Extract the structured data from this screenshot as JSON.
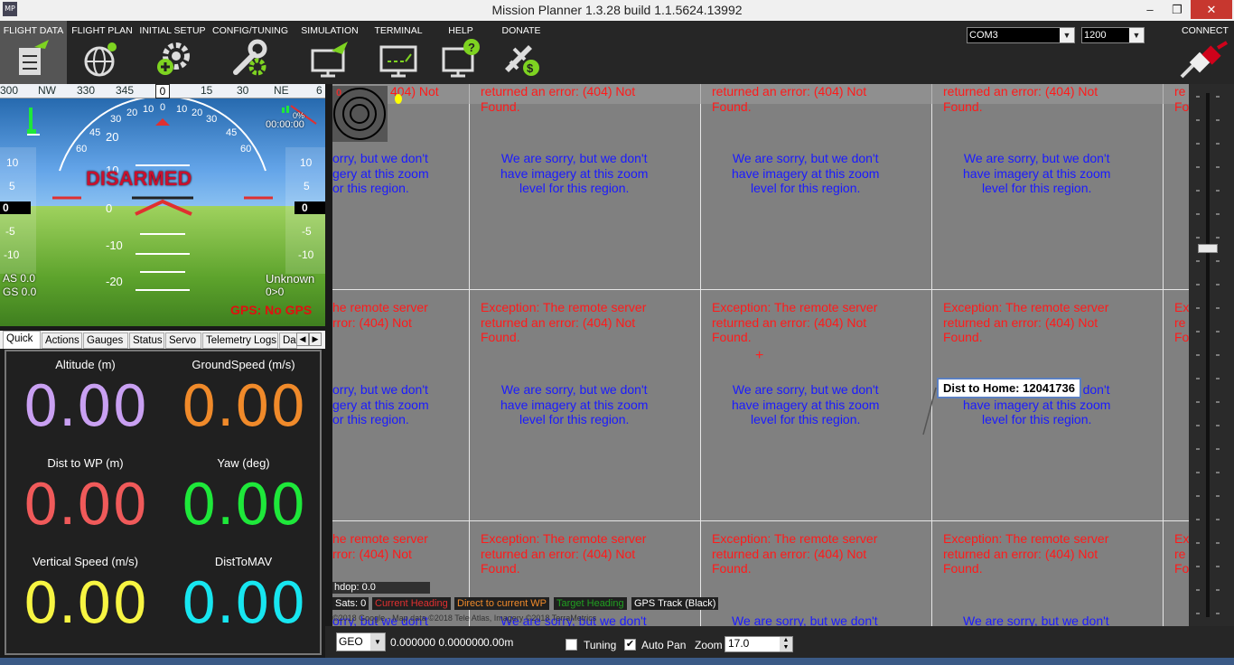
{
  "window": {
    "title": "Mission Planner 1.3.28 build 1.1.5624.13992",
    "icon_text": "MP",
    "minimize": "–",
    "restore": "❐",
    "close": "✕"
  },
  "menu": {
    "items": [
      {
        "label": "FLIGHT DATA",
        "icon": "flight-data-icon"
      },
      {
        "label": "FLIGHT PLAN",
        "icon": "flight-plan-icon"
      },
      {
        "label": "INITIAL SETUP",
        "icon": "initial-setup-icon"
      },
      {
        "label": "CONFIG/TUNING",
        "icon": "config-tuning-icon"
      },
      {
        "label": "SIMULATION",
        "icon": "simulation-icon"
      },
      {
        "label": "TERMINAL",
        "icon": "terminal-icon"
      },
      {
        "label": "HELP",
        "icon": "help-icon"
      },
      {
        "label": "DONATE",
        "icon": "donate-icon"
      }
    ],
    "port": "COM3",
    "baud": "1200",
    "connect_label": "CONNECT"
  },
  "hud": {
    "heading_ticks": [
      "300",
      "NW",
      "330",
      "345",
      "0",
      "15",
      "30",
      "NE",
      "6"
    ],
    "heading_value": "0",
    "status": "DISARMED",
    "roll_ticks": [
      "60",
      "45",
      "30",
      "20",
      "10",
      "0",
      "10",
      "20",
      "30",
      "45",
      "60"
    ],
    "pitch_labels": [
      "20",
      "10",
      "0",
      "-10",
      "-20"
    ],
    "left_tape": [
      "10",
      "5",
      "0",
      "-5",
      "-10"
    ],
    "right_tape": [
      "10",
      "5",
      "0",
      "-5",
      "-10"
    ],
    "as": "AS 0.0",
    "gs": "GS 0.0",
    "timer": "00:00:00",
    "mode": "Unknown",
    "wp": "0>0",
    "gps": "GPS: No GPS",
    "battery_marker": "0%"
  },
  "tabs": {
    "items": [
      "Quick",
      "Actions",
      "Gauges",
      "Status",
      "Servo",
      "Telemetry Logs",
      "Da"
    ],
    "scroll_left": "◀",
    "scroll_right": "▶"
  },
  "quick": [
    {
      "label": "Altitude (m)",
      "value": "0.00",
      "color": "#c9a0f2"
    },
    {
      "label": "GroundSpeed (m/s)",
      "value": "0.00",
      "color": "#f08a2a"
    },
    {
      "label": "Dist to WP (m)",
      "value": "0.00",
      "color": "#f05a5a"
    },
    {
      "label": "Yaw (deg)",
      "value": "0.00",
      "color": "#1ee83a"
    },
    {
      "label": "Vertical Speed (m/s)",
      "value": "0.00",
      "color": "#f7f542"
    },
    {
      "label": "DistToMAV",
      "value": "0.00",
      "color": "#17e6f0"
    }
  ],
  "map": {
    "error_full": "Exception: The remote server\nreturned an error: (404) Not\nFound.",
    "error_top": "returned an error: (404) Not\nFound.",
    "error_left": "he remote server\nrror: (404) Not",
    "error_left_top": "404) Not",
    "error_far": "Ex\nre\nFo",
    "error_far_top": "re\nFo",
    "sorry_full": "We are sorry, but we don't\nhave imagery at this zoom\nlevel for this region.",
    "sorry_left": "orry, but we don't\ngery at this zoom\nor this region.",
    "sorry_bottom": "We are sorry, but we don't",
    "sorry_bottom_left": "orry, but we don't",
    "home_marker": "0",
    "dist_to_home": "Dist to Home: 12041736",
    "hdop": "hdop: 0.0",
    "sats": "Sats: 0",
    "legend": [
      {
        "label": "Current Heading",
        "color": "#e03030"
      },
      {
        "label": "Direct to current WP",
        "color": "#f08a2a"
      },
      {
        "label": "Target Heading",
        "color": "#20a020"
      },
      {
        "label": "GPS Track (Black)",
        "color": "#ffffff"
      }
    ],
    "copyright": "©2018 Google - Map data ©2018 Tele Atlas, Imagery ©2018 TerraMetrics"
  },
  "bottom": {
    "coord_type": "GEO",
    "coords": "0.000000 0.000000",
    "alt": "0.00m",
    "tuning_label": "Tuning",
    "autopan_label": "Auto Pan",
    "zoom_label": "Zoom",
    "zoom_value": "17.0",
    "tuning_checked": "",
    "autopan_checked": "✔"
  }
}
